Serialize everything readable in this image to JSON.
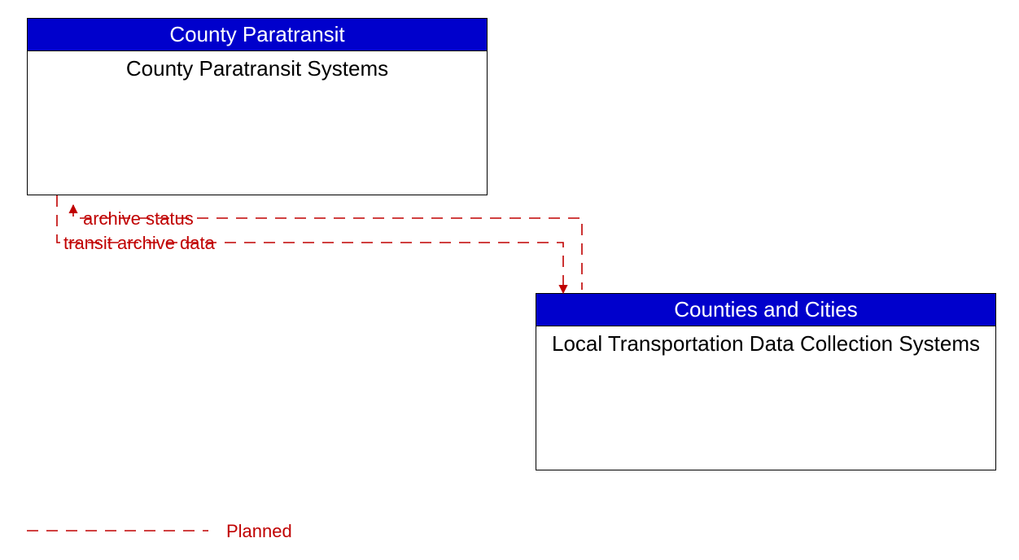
{
  "nodes": {
    "paratransit": {
      "header": "County Paratransit",
      "body": "County Paratransit Systems"
    },
    "local": {
      "header": "Counties and Cities",
      "body": "Local Transportation Data Collection Systems"
    }
  },
  "flows": {
    "archive_status": "archive status",
    "transit_archive_data": "transit archive data"
  },
  "legend": {
    "planned": "Planned"
  },
  "colors": {
    "header_bg": "#0000cc",
    "flow": "#c00000"
  }
}
